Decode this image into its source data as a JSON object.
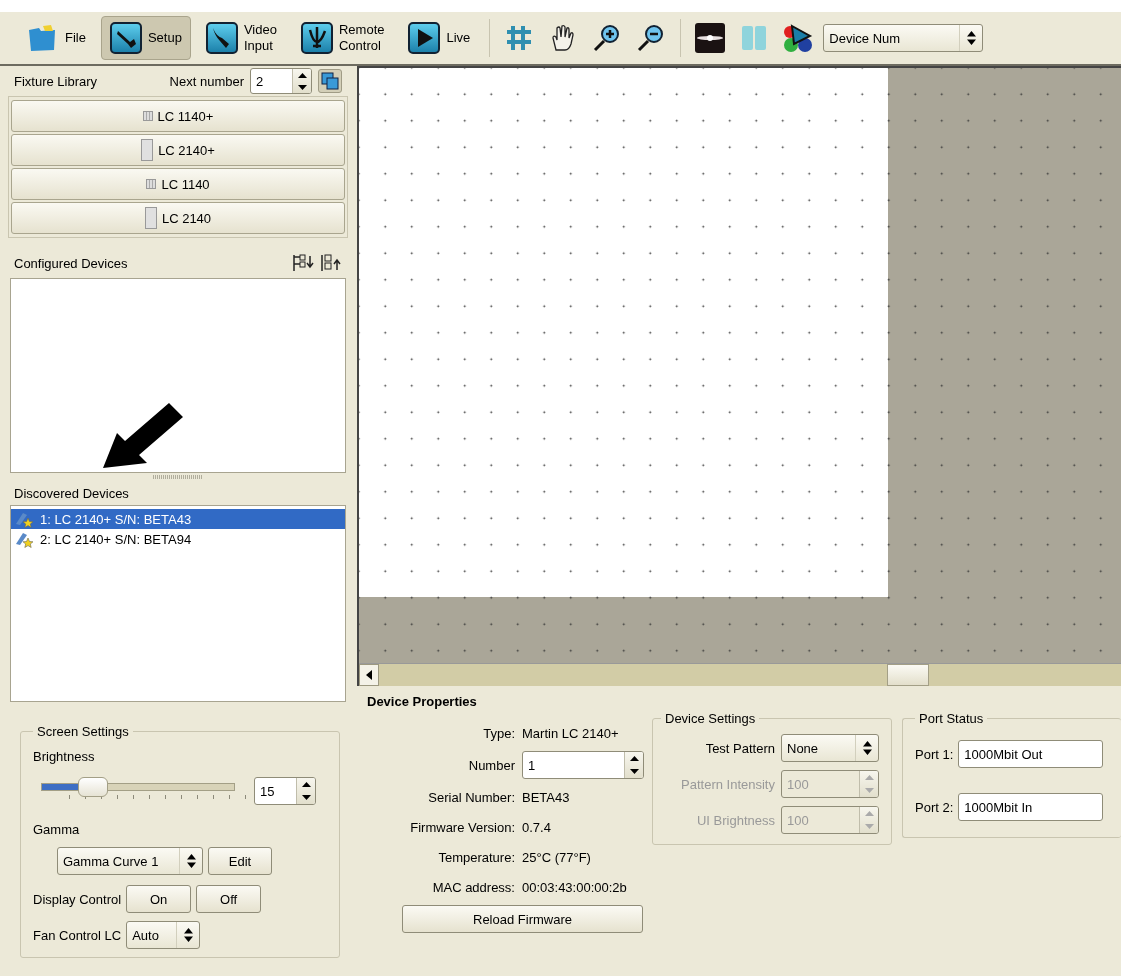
{
  "toolbar": {
    "items": [
      {
        "kind": "button",
        "lines": [
          "File"
        ],
        "selected": false
      },
      {
        "kind": "button",
        "lines": [
          "Setup"
        ],
        "selected": true
      },
      {
        "kind": "button",
        "lines": [
          "Video",
          "Input"
        ],
        "selected": false
      },
      {
        "kind": "button",
        "lines": [
          "Remote",
          "Control"
        ],
        "selected": false
      },
      {
        "kind": "button",
        "lines": [
          "Live"
        ],
        "selected": false
      },
      {
        "kind": "separator"
      },
      {
        "kind": "tool"
      },
      {
        "kind": "tool"
      },
      {
        "kind": "tool"
      },
      {
        "kind": "tool"
      },
      {
        "kind": "separator"
      },
      {
        "kind": "tool"
      },
      {
        "kind": "tool"
      },
      {
        "kind": "tool"
      }
    ],
    "dropdown": {
      "value": "Device Num"
    }
  },
  "fixture_library": {
    "title": "Fixture Library",
    "next_number_label": "Next number",
    "next_number": "2",
    "fixtures": [
      {
        "label": "LC 1140+",
        "kind": "small"
      },
      {
        "label": "LC 2140+",
        "kind": "tall"
      },
      {
        "label": "LC 1140",
        "kind": "small"
      },
      {
        "label": "LC 2140",
        "kind": "tall"
      }
    ]
  },
  "configured_devices": {
    "title": "Configured Devices"
  },
  "discovered_devices": {
    "title": "Discovered Devices",
    "items": [
      {
        "label": "1: LC 2140+ S/N: BETA43",
        "selected": true
      },
      {
        "label": "2: LC 2140+ S/N: BETA94",
        "selected": false
      }
    ]
  },
  "screen_settings": {
    "title": "Screen Settings",
    "brightness": {
      "label": "Brightness",
      "level": 0.22,
      "value": "15"
    },
    "gamma": {
      "label": "Gamma",
      "value": "Gamma Curve 1",
      "button": "Edit"
    },
    "display_control": {
      "label": "Display Control",
      "buttons": [
        "On",
        "Off"
      ]
    },
    "fan_control": {
      "label": "Fan Control LC",
      "value": "Auto"
    }
  },
  "device_properties": {
    "title": "Device Properties",
    "fields": [
      {
        "label": "Type:",
        "value": "Martin LC 2140+",
        "kind": "text"
      },
      {
        "label": "Number",
        "value": "1",
        "kind": "spin"
      },
      {
        "label": "Serial Number:",
        "value": "BETA43",
        "kind": "text"
      },
      {
        "label": "Firmware Version:",
        "value": "0.7.4",
        "kind": "text"
      },
      {
        "label": "Temperature:",
        "value": "25°C (77°F)",
        "kind": "text"
      },
      {
        "label": "MAC address:",
        "value": "00:03:43:00:00:2b",
        "kind": "text"
      }
    ],
    "button": "Reload Firmware"
  },
  "device_settings": {
    "title": "Device Settings",
    "fields": [
      {
        "label": "Test Pattern",
        "value": "None",
        "kind": "select",
        "disabled": false
      },
      {
        "label": "Pattern Intensity",
        "value": "100",
        "kind": "spin",
        "disabled": true
      },
      {
        "label": "UI Brightness",
        "value": "100",
        "kind": "spin",
        "disabled": true
      }
    ]
  },
  "port_status": {
    "title": "Port Status",
    "ports": [
      {
        "label": "Port 1:",
        "value": "1000Mbit Out"
      },
      {
        "label": "Port 2:",
        "value": "1000Mbit In"
      }
    ]
  }
}
